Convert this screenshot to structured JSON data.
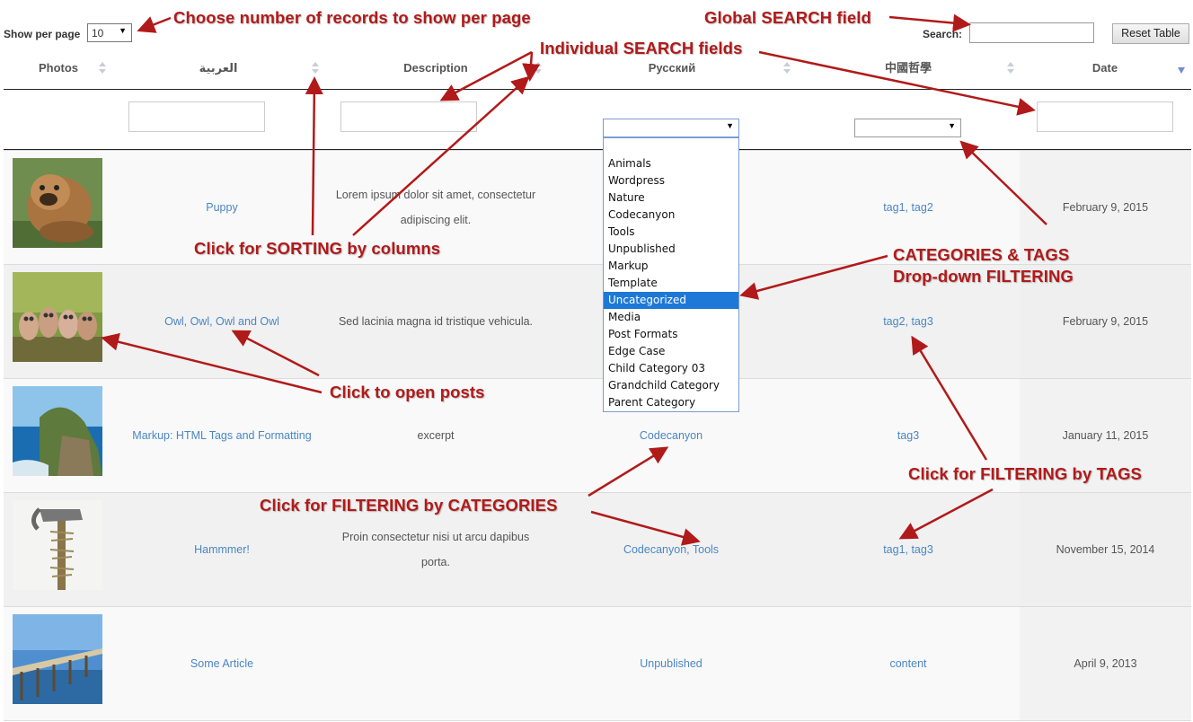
{
  "toolbar": {
    "show_per_page_label": "Show per page",
    "per_page_value": "10",
    "search_label": "Search:",
    "reset_label": "Reset Table"
  },
  "columns": [
    {
      "label": "Photos"
    },
    {
      "label": "العربية"
    },
    {
      "label": "Description"
    },
    {
      "label": "Русский"
    },
    {
      "label": "中國哲學"
    },
    {
      "label": "Date"
    }
  ],
  "category_options": [
    "Animals",
    "Wordpress",
    "Nature",
    "Codecanyon",
    "Tools",
    "Unpublished",
    "Markup",
    "Template",
    "Uncategorized",
    "Media",
    "Post Formats",
    "Edge Case",
    "Child Category 03",
    "Grandchild Category",
    "Parent Category"
  ],
  "category_selected": "Uncategorized",
  "rows": [
    {
      "title": "Puppy",
      "desc_line1": "Lorem ipsum dolor sit amet, consectetur",
      "desc_line2": "adipiscing elit.",
      "categories": "",
      "tags": "tag1, tag2",
      "date": "February 9, 2015",
      "photo": "puppy"
    },
    {
      "title": "Owl, Owl, Owl and Owl",
      "desc_line1": "Sed lacinia magna id tristique vehicula.",
      "desc_line2": "",
      "categories": "",
      "tags": "tag2, tag3",
      "date": "February 9, 2015",
      "photo": "owls"
    },
    {
      "title": "Markup: HTML Tags and Formatting",
      "desc_line1": "excerpt",
      "desc_line2": "",
      "categories": "Codecanyon",
      "tags": "tag3",
      "date": "January 11, 2015",
      "photo": "coast"
    },
    {
      "title": "Hammmer!",
      "desc_line1": "Proin consectetur nisi ut arcu dapibus",
      "desc_line2": "porta.",
      "categories": "Codecanyon, Tools",
      "tags": "tag1, tag3",
      "date": "November 15, 2014",
      "photo": "hammer"
    },
    {
      "title": "Some Article",
      "desc_line1": "",
      "desc_line2": "",
      "categories": "Unpublished",
      "tags": "content",
      "date": "April 9, 2013",
      "photo": "pier"
    }
  ],
  "annotations": {
    "per_page": "Choose number of records to show per page",
    "global_search": "Global SEARCH field",
    "individual_search": "Individual SEARCH fields",
    "sorting": "Click for SORTING by columns",
    "cat_tags_line1": "CATEGORIES & TAGS",
    "cat_tags_line2": "Drop-down FILTERING",
    "open_posts": "Click to open posts",
    "filter_tags": "Click for FILTERING by TAGS",
    "filter_categories": "Click for FILTERING by CATEGORIES"
  },
  "colors": {
    "link": "#4a86c5",
    "annotation": "#b11a1a",
    "dropdown_highlight": "#1e78d7"
  }
}
